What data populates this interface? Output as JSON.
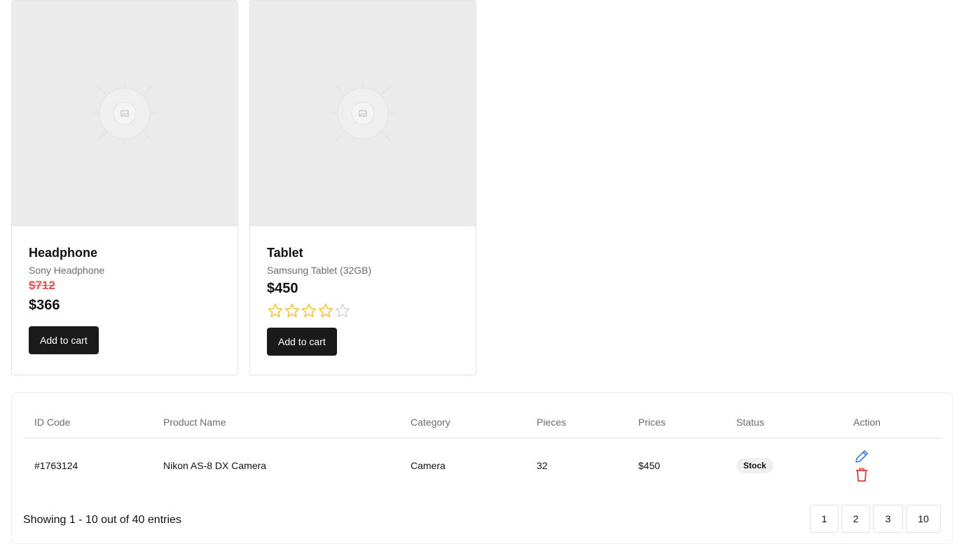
{
  "products": [
    {
      "title": "Headphone",
      "subtitle": "Sony Headphone",
      "old_price": "$712",
      "price": "$366",
      "button": "Add to cart"
    },
    {
      "title": "Tablet",
      "subtitle": "Samsung Tablet (32GB)",
      "price": "$450",
      "rating": 4,
      "rating_max": 5,
      "button": "Add to cart"
    }
  ],
  "table": {
    "headers": [
      "ID Code",
      "Product Name",
      "Category",
      "Pieces",
      "Prices",
      "Status",
      "Action"
    ],
    "rows": [
      {
        "id": "#1763124",
        "name": "Nikon AS-8 DX Camera",
        "category": "Camera",
        "pieces": "32",
        "price": "$450",
        "status": "Stock"
      }
    ]
  },
  "footer": {
    "showing": "Showing 1 - 10 out of 40 entries",
    "pages": [
      "1",
      "2",
      "3",
      "10"
    ]
  },
  "colors": {
    "button_bg": "#1a1a1a",
    "old_price": "#e05353",
    "star": "#f2c230",
    "edit_icon": "#3d7fd6",
    "delete_icon": "#e03a3a"
  }
}
